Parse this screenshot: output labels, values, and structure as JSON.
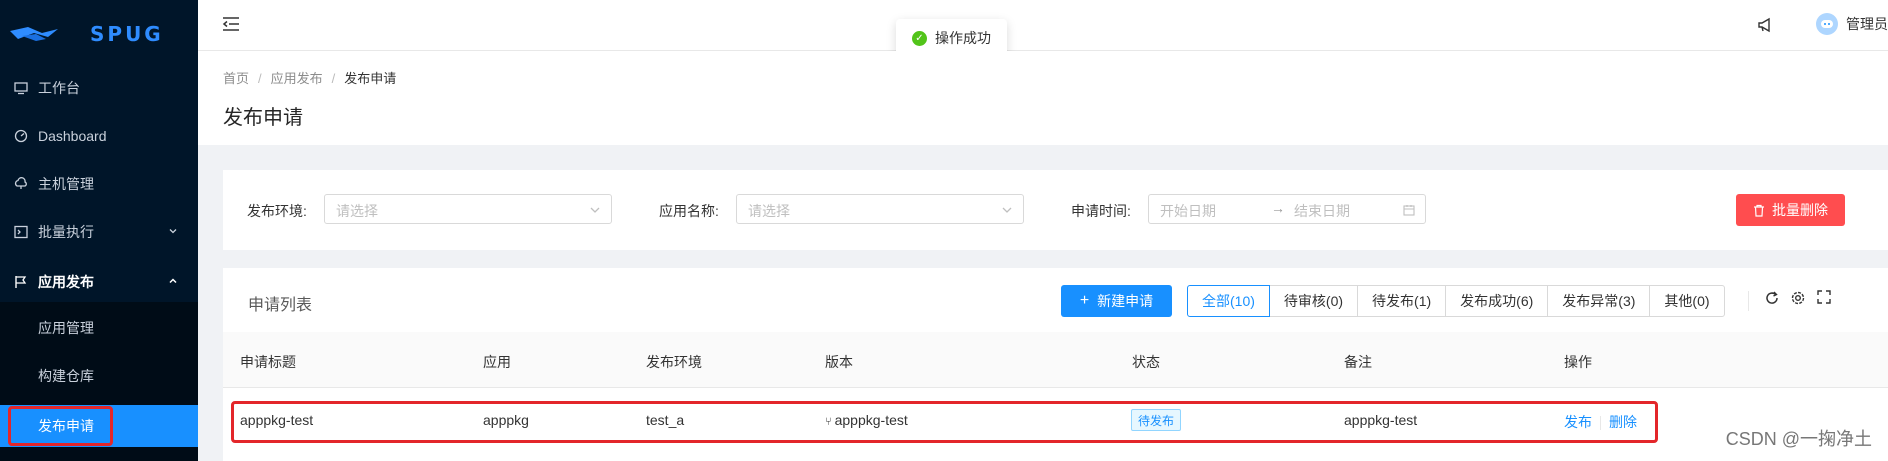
{
  "app": {
    "logo_text": "SPUG"
  },
  "sidebar": {
    "items": [
      {
        "label": "工作台",
        "icon": "monitor-icon"
      },
      {
        "label": "Dashboard",
        "icon": "dashboard-icon"
      },
      {
        "label": "主机管理",
        "icon": "cloud-server-icon"
      },
      {
        "label": "批量执行",
        "icon": "terminal-icon",
        "caret": "chevron-down"
      },
      {
        "label": "应用发布",
        "icon": "flag-icon",
        "caret": "chevron-up",
        "expanded": true
      }
    ],
    "subitems": [
      {
        "label": "应用管理"
      },
      {
        "label": "构建仓库"
      },
      {
        "label": "发布申请",
        "active": true
      }
    ]
  },
  "header": {
    "user_name": "管理员"
  },
  "toast": {
    "text": "操作成功",
    "type": "success"
  },
  "breadcrumb": {
    "items": [
      "首页",
      "应用发布",
      "发布申请"
    ]
  },
  "page": {
    "title": "发布申请"
  },
  "filters": {
    "env_label": "发布环境:",
    "env_placeholder": "请选择",
    "app_label": "应用名称:",
    "app_placeholder": "请选择",
    "time_label": "申请时间:",
    "start_placeholder": "开始日期",
    "end_placeholder": "结束日期",
    "batch_delete_label": "批量删除"
  },
  "list": {
    "title": "申请列表",
    "new_button_label": "新建申请",
    "tabs": [
      {
        "label": "全部(10)",
        "active": true
      },
      {
        "label": "待审核(0)"
      },
      {
        "label": "待发布(1)"
      },
      {
        "label": "发布成功(6)"
      },
      {
        "label": "发布异常(3)"
      },
      {
        "label": "其他(0)"
      }
    ],
    "columns": [
      "申请标题",
      "应用",
      "发布环境",
      "版本",
      "状态",
      "备注",
      "操作"
    ],
    "rows": [
      {
        "title": "apppkg-test",
        "app": "apppkg",
        "env": "test_a",
        "version": "apppkg-test",
        "status": "待发布",
        "remark": "apppkg-test",
        "actions": [
          "发布",
          "删除"
        ]
      }
    ]
  },
  "watermark": "CSDN @一掬净土",
  "colors": {
    "primary": "#1890ff",
    "danger": "#ff4d4f",
    "sidebar_bg": "#001529",
    "success": "#52c41a",
    "highlight": "#e3262a"
  }
}
